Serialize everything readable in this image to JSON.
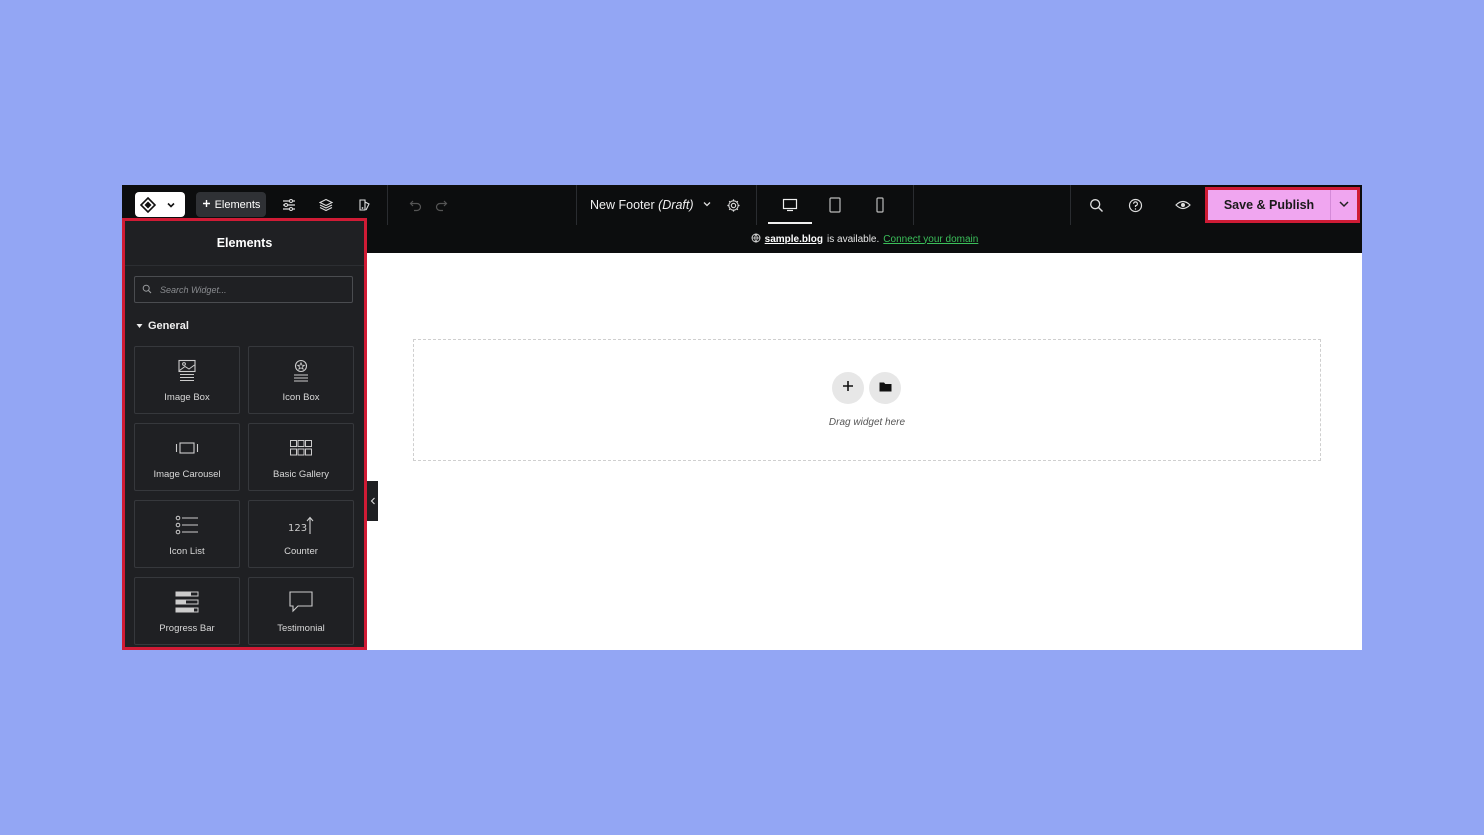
{
  "topbar": {
    "elements_label": "Elements",
    "page_name": "New Footer",
    "page_status": "(Draft)",
    "publish_label": "Save & Publish"
  },
  "notice": {
    "domain": "sample.blog",
    "text": "is available.",
    "link": "Connect your domain"
  },
  "sidebar": {
    "title": "Elements",
    "search_placeholder": "Search Widget...",
    "section": "General",
    "widgets": [
      {
        "label": "Image Box",
        "icon": "image-box-icon"
      },
      {
        "label": "Icon Box",
        "icon": "icon-box-icon"
      },
      {
        "label": "Image Carousel",
        "icon": "image-carousel-icon"
      },
      {
        "label": "Basic Gallery",
        "icon": "basic-gallery-icon"
      },
      {
        "label": "Icon List",
        "icon": "icon-list-icon"
      },
      {
        "label": "Counter",
        "icon": "counter-icon"
      },
      {
        "label": "Progress Bar",
        "icon": "progress-bar-icon"
      },
      {
        "label": "Testimonial",
        "icon": "testimonial-icon"
      }
    ]
  },
  "canvas": {
    "drop_text": "Drag widget here"
  },
  "colors": {
    "background": "#93a6f4",
    "topbar": "#0c0d0e",
    "sidebar": "#1f2023",
    "publish": "#f0a6f0",
    "highlight": "#d01b35",
    "link": "#3bbf5a"
  }
}
